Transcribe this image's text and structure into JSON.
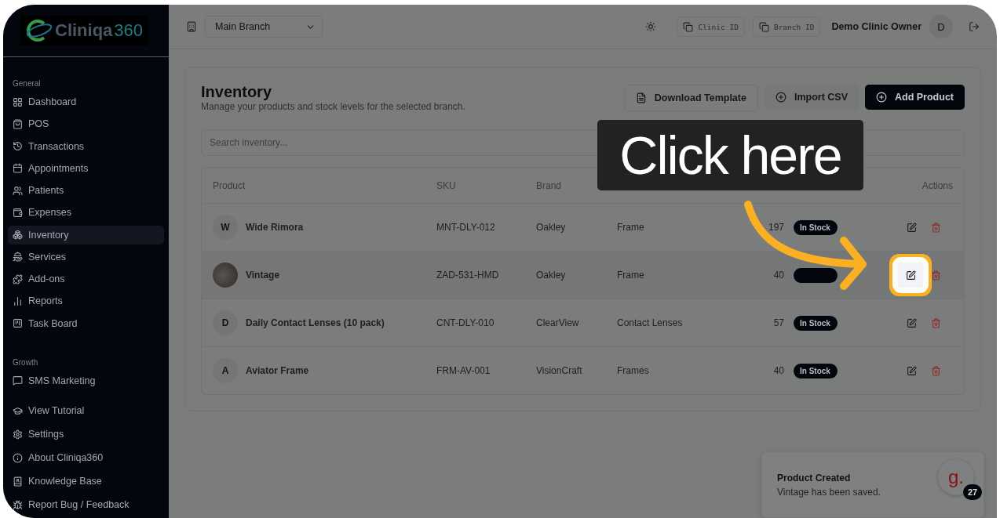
{
  "sidebar": {
    "logo": {
      "text": "Cliniqa",
      "suffix": "360"
    },
    "sections": [
      {
        "title": "General",
        "items": [
          {
            "label": "Dashboard",
            "selected": false
          },
          {
            "label": "POS",
            "selected": false
          },
          {
            "label": "Transactions",
            "selected": false
          },
          {
            "label": "Appointments",
            "selected": false
          },
          {
            "label": "Patients",
            "selected": false
          },
          {
            "label": "Expenses",
            "selected": false
          },
          {
            "label": "Inventory",
            "selected": true
          },
          {
            "label": "Services",
            "selected": false
          },
          {
            "label": "Add-ons",
            "selected": false
          },
          {
            "label": "Reports",
            "selected": false
          },
          {
            "label": "Task Board",
            "selected": false
          }
        ]
      },
      {
        "title": "Growth",
        "items": [
          {
            "label": "SMS Marketing",
            "selected": false
          }
        ]
      }
    ],
    "footer": [
      {
        "label": "View Tutorial"
      },
      {
        "label": "Settings"
      },
      {
        "label": "About Cliniqa360"
      },
      {
        "label": "Knowledge Base"
      },
      {
        "label": "Report Bug / Feedback"
      }
    ]
  },
  "topbar": {
    "branch": "Main Branch",
    "clinic_id": "Clinic ID",
    "branch_id": "Branch ID",
    "user": "Demo Clinic Owner",
    "avatar": "D"
  },
  "page": {
    "title": "Inventory",
    "subtitle": "Manage your products and stock levels for the selected branch.",
    "buttons": [
      {
        "label": "Download Template",
        "kind": "file"
      },
      {
        "label": "Import CSV",
        "kind": "import"
      },
      {
        "label": "Add Product",
        "kind": "primary"
      }
    ],
    "search": {
      "placeholder": "Search inventory..."
    }
  },
  "table": {
    "columns": [
      "Product",
      "SKU",
      "Brand",
      null,
      null,
      null,
      "Actions"
    ],
    "rows": [
      {
        "avatar": "W",
        "kind": "letter",
        "product": "Wide Rimora",
        "sku": "MNT-DLY-012",
        "brand": "Oakley",
        "category": "Frame",
        "stock": "197",
        "status": "In Stock",
        "highlighted": false
      },
      {
        "kind": "photo",
        "product": "Vintage",
        "sku": "ZAD-531-HMD",
        "brand": "Oakley",
        "category": "Frame",
        "stock": "40",
        "highlighted": true
      },
      {
        "avatar": "D",
        "kind": "letter",
        "product": "Daily Contact Lenses (10 pack)",
        "sku": "CNT-DLY-010",
        "brand": "ClearView",
        "category": "Contact Lenses",
        "stock": "57",
        "status": "In Stock",
        "highlighted": false
      },
      {
        "avatar": "A",
        "kind": "letter",
        "product": "Aviator Frame",
        "sku": "FRM-AV-001",
        "brand": "VisionCraft",
        "category": "Frames",
        "stock": "40",
        "status": "In Stock",
        "highlighted": false
      }
    ]
  },
  "callout": {
    "text": "Click here"
  },
  "toast": {
    "title": "Product Created",
    "message": "Vintage has been saved.",
    "widget": "g.",
    "badge": "27"
  }
}
